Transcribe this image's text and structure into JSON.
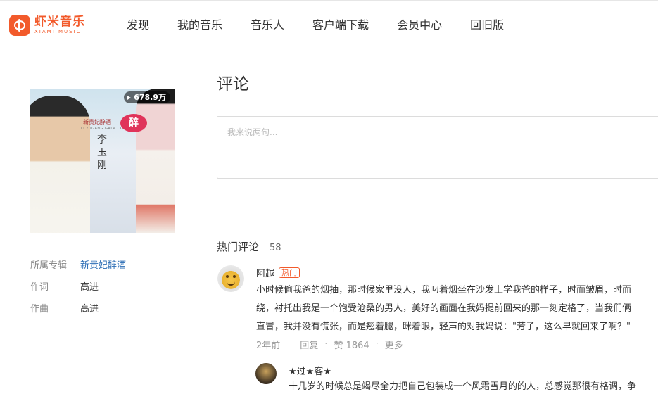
{
  "header": {
    "logo_cn": "虾米音乐",
    "logo_en": "XIAMI MUSIC",
    "nav": [
      "发现",
      "我的音乐",
      "音乐人",
      "客户端下载",
      "会员中心",
      "回旧版"
    ]
  },
  "album": {
    "cover_title": "新贵妃醉酒",
    "cover_subtitle": "LI YUGANG GALA CONCERT",
    "cover_badge": "醉",
    "cover_artist": "李玉刚",
    "play_count": "678.9万"
  },
  "meta": [
    {
      "label": "所属专辑",
      "value": "新贵妃醉酒"
    },
    {
      "label": "作词",
      "value": "高进"
    },
    {
      "label": "作曲",
      "value": "高进"
    }
  ],
  "comments": {
    "title": "评论",
    "placeholder": "我来说两句...",
    "hot_title": "热门评论",
    "hot_count": "58",
    "items": [
      {
        "user": "阿越",
        "badge": "热门",
        "lines": [
          "小时候偷我爸的烟抽，那时候家里没人，我叼着烟坐在沙发上学我爸的样子，时而皱眉，时而",
          "绕，衬托出我是一个饱受沧桑的男人，美好的画面在我妈提前回来的那一刻定格了，当我们俩",
          "直冒，我并没有慌张，而是翘着腿，眯着眼，轻声的对我妈说：\"芳子，这么早就回来了啊？\""
        ],
        "time": "2年前",
        "reply": "回复",
        "like": "赞 1864",
        "more": "更多"
      },
      {
        "user": "★过★客★",
        "lines": [
          "十几岁的时候总是竭尽全力把自己包装成一个风霜雪月的的人，总感觉那很有格调，争"
        ]
      }
    ]
  }
}
